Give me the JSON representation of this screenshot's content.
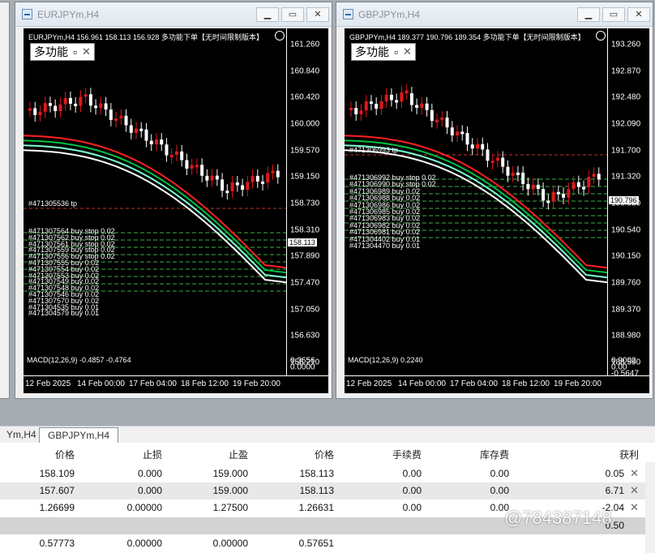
{
  "windows": [
    {
      "title": "EURJPYm,H4",
      "info": "EURJPYm,H4  156.961 158.113 156.928",
      "info_right": "多功能下单【无时间限制版本】",
      "panel_label": "多功能",
      "price_ticks": [
        "161.260",
        "160.840",
        "160.420",
        "160.000",
        "159.570",
        "159.150",
        "158.730",
        "158.310",
        "157.890",
        "157.470",
        "157.050",
        "156.630",
        "156.210"
      ],
      "price_tag": "158.113",
      "time_ticks": [
        "12 Feb 2025",
        "14 Feb 00:00",
        "17 Feb 04:00",
        "18 Feb 12:00",
        "19 Feb 20:00"
      ],
      "orders": [
        "#471307564 buy stop 0.02",
        "#471307562 buy stop 0.02",
        "#471307561 buy stop 0.02",
        "#471307559 buy stop 0.02",
        "#471307556 buy stop 0.02",
        "#471307555 buy 0.02",
        "#471307554 buy 0.02",
        "#471307553 buy 0.02",
        "#471307549 buy 0.02",
        "#471307548 buy 0.02",
        "#471307546 buy 0.02",
        "#471307570 buy 0.02",
        "#471304535 buy 0.01",
        "#471304579 buy 0.01"
      ],
      "tp_label": "#471305536 tp",
      "sub_label": "MACD(12,26,9) -0.4857 -0.4764",
      "sub_ticks": [
        "0.3656",
        "0.0000"
      ]
    },
    {
      "title": "GBPJPYm,H4",
      "info": "GBPJPYm,H4  189.377 190.796 189.354",
      "info_right": "多功能下单【无时间限制版本】",
      "panel_label": "多功能",
      "price_ticks": [
        "193.260",
        "192.870",
        "192.480",
        "192.090",
        "191.700",
        "191.320",
        "190.930",
        "190.540",
        "190.150",
        "189.760",
        "189.370",
        "188.980",
        "188.590"
      ],
      "price_tag": "190.796",
      "time_ticks": [
        "12 Feb 2025",
        "14 Feb 00:00",
        "17 Feb 04:00",
        "18 Feb 12:00",
        "19 Feb 20:00"
      ],
      "orders": [
        "#471306992 buy stop 0.02",
        "#471306990 buy stop 0.02",
        "#471306989 buy 0.02",
        "#471306988 buy 0.02",
        "#471306986 buy 0.02",
        "#471306985 buy 0.02",
        "#471306983 buy 0.02",
        "#471306982 buy 0.02",
        "#471306981 buy 0.02",
        "#471304402 buy 0.01",
        "#471304470 buy 0.01"
      ],
      "tp_label": "#471306993 tp",
      "sub_label": "MACD(12,26,9) 0.2240",
      "sub_ticks": [
        "0.9002",
        "0.00",
        "-0.5647"
      ]
    }
  ],
  "tabs": [
    "Ym,H4",
    "GBPJPYm,H4"
  ],
  "columns": [
    "价格",
    "止损",
    "止盈",
    "价格",
    "手续费",
    "库存费",
    "获利"
  ],
  "rows": [
    [
      "158.109",
      "0.000",
      "159.000",
      "158.113",
      "0.00",
      "0.00",
      "0.05"
    ],
    [
      "157.607",
      "0.000",
      "159.000",
      "158.113",
      "0.00",
      "0.00",
      "6.71"
    ],
    [
      "1.26699",
      "0.00000",
      "1.27500",
      "1.26631",
      "0.00",
      "0.00",
      "-2.04"
    ],
    [
      "0.57773",
      "0.00000",
      "0.00000",
      "0.57651",
      "",
      "",
      ""
    ]
  ],
  "watermark": "@784387148",
  "section_value": "0.50"
}
